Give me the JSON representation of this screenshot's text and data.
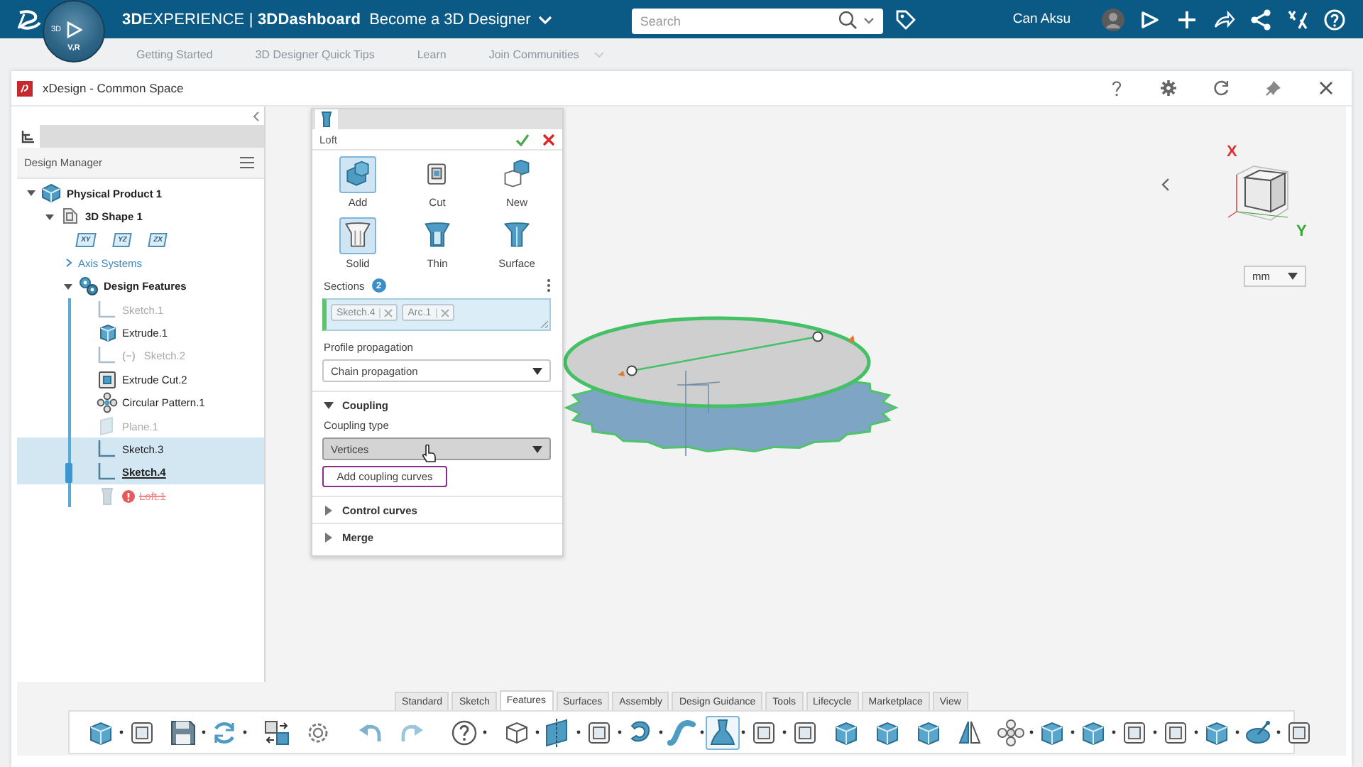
{
  "topbar": {
    "title": "**3D**EXPERIENCE | **3DDashboard**",
    "dashboard": "Become a 3D Designer",
    "search": {
      "placeholder": "Search"
    },
    "user": "Can Aksu"
  },
  "compass": {
    "top": "3D",
    "bottom": "V,R"
  },
  "dashboard_tabs": [
    "Getting Started",
    "3D Designer Quick Tips",
    "Learn",
    "Join Communities"
  ],
  "app": {
    "title": "xDesign - Common Space"
  },
  "design_manager": {
    "title": "Design Manager",
    "tree": [
      {
        "label": "Physical Product 1",
        "kind": "product",
        "expanded": true,
        "children": [
          {
            "label": "3D Shape 1",
            "kind": "shape",
            "expanded": true,
            "planes": [
              "XY",
              "YZ",
              "ZX"
            ],
            "children": [
              {
                "label": "Axis Systems",
                "kind": "link",
                "expanded": false
              },
              {
                "label": "Design Features",
                "kind": "features",
                "expanded": true,
                "children": [
                  {
                    "label": "Sketch.1",
                    "kind": "sketch",
                    "selected": false,
                    "dimmed": true,
                    "current": false,
                    "error": false
                  },
                  {
                    "label": "Extrude.1",
                    "kind": "extrude",
                    "selected": false,
                    "dimmed": false,
                    "current": false,
                    "error": false
                  },
                  {
                    "label": "Sketch.2",
                    "kind": "sketch",
                    "tag": "(−)",
                    "selected": false,
                    "dimmed": true,
                    "current": false,
                    "error": false
                  },
                  {
                    "label": "Extrude Cut.2",
                    "kind": "cut",
                    "selected": false,
                    "dimmed": false,
                    "current": false,
                    "error": false
                  },
                  {
                    "label": "Circular Pattern.1",
                    "kind": "pattern",
                    "selected": false,
                    "dimmed": false,
                    "current": false,
                    "error": false
                  },
                  {
                    "label": "Plane.1",
                    "kind": "plane",
                    "selected": false,
                    "dimmed": true,
                    "current": false,
                    "error": false
                  },
                  {
                    "label": "Sketch.3",
                    "kind": "sketch",
                    "selected": true,
                    "dimmed": false,
                    "current": false,
                    "error": false
                  },
                  {
                    "label": "Sketch.4",
                    "kind": "sketch",
                    "selected": true,
                    "dimmed": false,
                    "current": true,
                    "error": false
                  },
                  {
                    "label": "Loft.1",
                    "kind": "loft",
                    "selected": false,
                    "dimmed": true,
                    "current": false,
                    "error": true
                  }
                ]
              }
            ]
          }
        ]
      }
    ]
  },
  "loft_panel": {
    "title": "Loft",
    "operations": [
      {
        "label": "Add",
        "kind": "add",
        "selected": true
      },
      {
        "label": "Cut",
        "kind": "cut",
        "selected": false
      },
      {
        "label": "New",
        "kind": "new",
        "selected": false
      }
    ],
    "body_types": [
      {
        "label": "Solid",
        "kind": "solid",
        "selected": true
      },
      {
        "label": "Thin",
        "kind": "thin",
        "selected": false
      },
      {
        "label": "Surface",
        "kind": "surface",
        "selected": false
      }
    ],
    "sections": {
      "label": "Sections",
      "count": "2",
      "items": [
        "Sketch.4",
        "Arc.1"
      ]
    },
    "profile_propagation": {
      "label": "Profile propagation",
      "value": "Chain propagation",
      "hovered": false
    },
    "groups": [
      {
        "title": "Coupling",
        "expanded": true,
        "type_label": "Coupling type",
        "type_value": "Vertices",
        "hovered": true,
        "button": "Add coupling curves",
        "focused": true
      },
      {
        "title": "Control curves",
        "expanded": false
      },
      {
        "title": "Merge",
        "expanded": false
      }
    ]
  },
  "viewport": {
    "units": "mm",
    "axis_x": "X",
    "axis_y": "Y"
  },
  "toolbar": {
    "tabs": [
      {
        "label": "Standard",
        "selected": false
      },
      {
        "label": "Sketch",
        "selected": false
      },
      {
        "label": "Features",
        "selected": true
      },
      {
        "label": "Surfaces",
        "selected": false
      },
      {
        "label": "Assembly",
        "selected": false
      },
      {
        "label": "Design Guidance",
        "selected": false
      },
      {
        "label": "Tools",
        "selected": false
      },
      {
        "label": "Lifecycle",
        "selected": false
      },
      {
        "label": "Marketplace",
        "selected": false
      },
      {
        "label": "View",
        "selected": false
      }
    ],
    "groups": [
      {
        "tools": [
          {
            "kind": "solid",
            "menu": true,
            "selected": false
          },
          {
            "kind": "outline",
            "menu": false,
            "selected": false
          },
          {
            "kind": "save",
            "menu": true,
            "selected": false
          },
          {
            "kind": "arrows",
            "menu": true,
            "selected": false
          }
        ]
      },
      {
        "tools": [
          {
            "kind": "swap",
            "menu": false,
            "selected": false
          },
          {
            "kind": "gear",
            "menu": false,
            "selected": false
          }
        ]
      },
      {
        "tools": [
          {
            "kind": "undo",
            "menu": false,
            "selected": false
          },
          {
            "kind": "redo",
            "menu": false,
            "selected": false
          }
        ]
      },
      {
        "tools": [
          {
            "kind": "help",
            "menu": true,
            "selected": false
          }
        ]
      },
      {
        "tools": [
          {
            "kind": "cube",
            "menu": true,
            "selected": false
          },
          {
            "kind": "plane",
            "menu": true,
            "selected": false
          },
          {
            "kind": "outline",
            "menu": true,
            "selected": false
          },
          {
            "kind": "hook",
            "menu": true,
            "selected": false
          },
          {
            "kind": "curve",
            "menu": true,
            "selected": false
          },
          {
            "kind": "tapered",
            "menu": true,
            "selected": true
          },
          {
            "kind": "outline",
            "menu": true,
            "selected": false
          },
          {
            "kind": "outline",
            "menu": false,
            "selected": false
          },
          {
            "kind": "solid",
            "menu": false,
            "selected": false
          },
          {
            "kind": "solid",
            "menu": false,
            "selected": false
          },
          {
            "kind": "solid",
            "menu": false,
            "selected": false
          },
          {
            "kind": "mirror",
            "menu": false,
            "selected": false
          },
          {
            "kind": "cluster",
            "menu": true,
            "selected": false
          },
          {
            "kind": "solid",
            "menu": true,
            "selected": false
          },
          {
            "kind": "solid",
            "menu": true,
            "selected": false
          },
          {
            "kind": "outline",
            "menu": true,
            "selected": false
          },
          {
            "kind": "outline",
            "menu": true,
            "selected": false
          },
          {
            "kind": "solid",
            "menu": true,
            "selected": false
          },
          {
            "kind": "dish",
            "menu": true,
            "selected": false
          },
          {
            "kind": "outline",
            "menu": false,
            "selected": false
          }
        ]
      }
    ]
  }
}
